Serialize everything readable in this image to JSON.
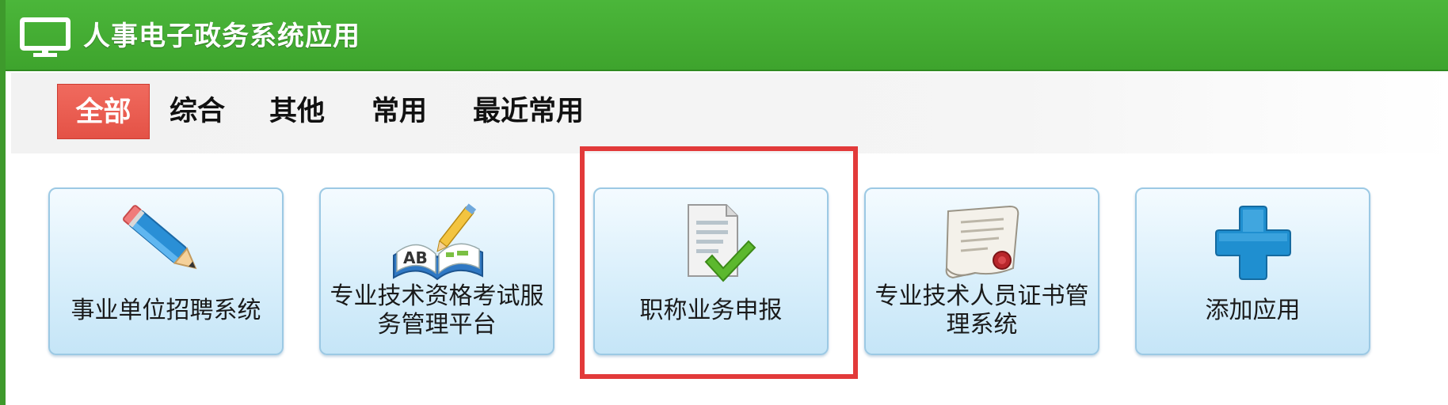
{
  "window": {
    "title": "人事电子政务系统应用",
    "icon": "monitor-icon"
  },
  "tabs": [
    {
      "label": "全部",
      "active": true
    },
    {
      "label": "综合",
      "active": false
    },
    {
      "label": "其他",
      "active": false
    },
    {
      "label": "常用",
      "active": false
    },
    {
      "label": "最近常用",
      "active": false
    }
  ],
  "apps": [
    {
      "label": "事业单位招聘系统",
      "icon": "pencil-icon"
    },
    {
      "label": "专业技术资格考试服务管理平台",
      "icon": "book-pen-icon"
    },
    {
      "label": "职称业务申报",
      "icon": "document-check-icon",
      "highlighted": true
    },
    {
      "label": "专业技术人员证书管理系统",
      "icon": "certificate-icon"
    },
    {
      "label": "添加应用",
      "icon": "plus-icon"
    }
  ],
  "colors": {
    "titlebar": "#3ea42d",
    "active_tab": "#e45246",
    "tile_border": "#9cc9e4",
    "highlight": "#e23a3a"
  }
}
